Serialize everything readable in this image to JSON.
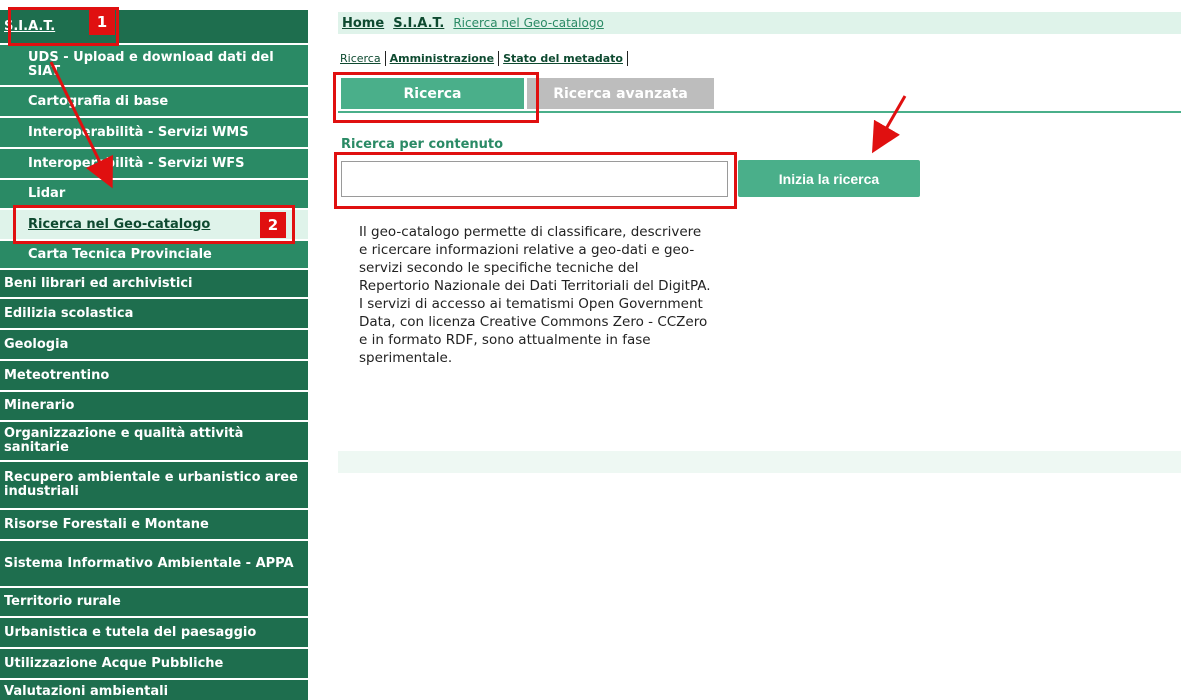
{
  "sidebar": {
    "root": "S.I.A.T.",
    "sub": [
      "UDS - Upload e download dati del SIAT",
      "Cartografia di base",
      "Interoperabilità - Servizi WMS",
      "Interoperabilità - Servizi WFS",
      "Lidar",
      "Ricerca nel Geo-catalogo",
      "Carta Tecnica Provinciale"
    ],
    "sections": [
      "Beni librari ed archivistici",
      "Edilizia scolastica",
      "Geologia",
      "Meteotrentino",
      "Minerario",
      "Organizzazione e qualità attività sanitarie",
      "Recupero ambientale e urbanistico aree industriali",
      "Risorse Forestali e Montane",
      "Sistema Informativo Ambientale - APPA",
      "Territorio rurale",
      "Urbanistica e tutela del paesaggio",
      "Utilizzazione Acque Pubbliche",
      "Valutazioni ambientali"
    ]
  },
  "breadcrumb": {
    "home": "Home",
    "siat": "S.I.A.T.",
    "current": "Ricerca nel Geo-catalogo"
  },
  "subnav": {
    "ricerca": "Ricerca",
    "amministrazione": "Amministrazione",
    "stato": "Stato del metadato"
  },
  "tabs": {
    "ricerca": "Ricerca",
    "avanzata": "Ricerca avanzata"
  },
  "search": {
    "label": "Ricerca per contenuto",
    "value": "",
    "button": "Inizia la ricerca"
  },
  "description": "Il geo-catalogo permette di classificare, descrivere e ricercare informazioni relative a geo-dati e geo-servizi secondo le specifiche tecniche del Repertorio Nazionale dei Dati Territoriali del DigitPA. I servizi di accesso ai tematismi Open Government Data, con licenza Creative Commons Zero - CCZero e in formato RDF, sono attualmente in fase sperimentale.",
  "annotations": {
    "badge1": "1",
    "badge2": "2",
    "color": "#e01010"
  }
}
